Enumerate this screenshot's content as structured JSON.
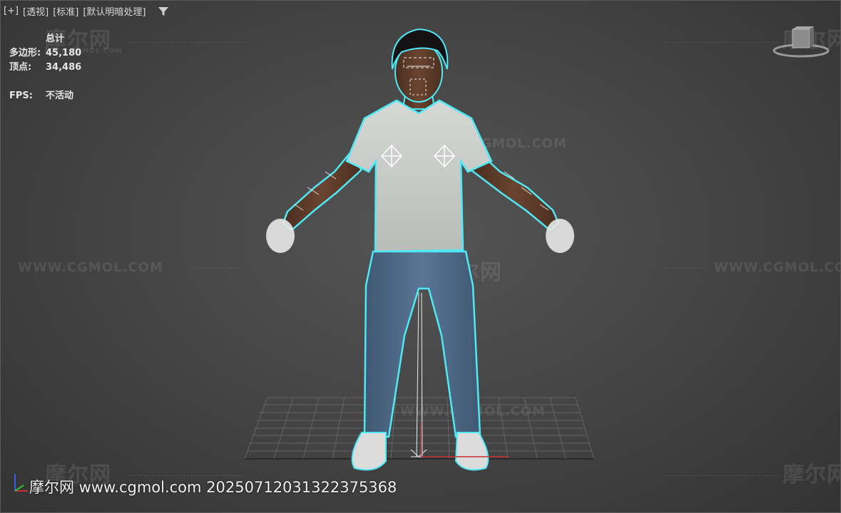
{
  "viewport_header": {
    "plus_menu": "[+]",
    "view_menu": "[透视]",
    "shading_menu": "[标准]",
    "lighting_menu": "[默认明暗处理]"
  },
  "stats": {
    "total_label": "总计",
    "polygons_label": "多边形:",
    "polygons_value": "45,180",
    "vertices_label": "顶点:",
    "vertices_value": "34,486",
    "fps_label": "FPS:",
    "fps_value": "不活动"
  },
  "watermarks": {
    "url": "WWW.CGMOL.COM",
    "logo": "摩尔网"
  },
  "footer_watermark": "摩尔网 www.cgmol.com 20250712031322375368",
  "colors": {
    "selection_outline": "#4fe8f5",
    "shirt": "#cfd1cf",
    "jeans": "#4e6a86",
    "skin": "#5a3a28",
    "hair": "#141212",
    "grid": "#6a6a6a",
    "axis_x": "#c83030",
    "axis_y": "#30c030",
    "axis_z": "#3060e0"
  },
  "icons": {
    "filter": "filter-icon",
    "viewcube": "viewcube-icon",
    "axis": "axis-tripod-icon"
  }
}
